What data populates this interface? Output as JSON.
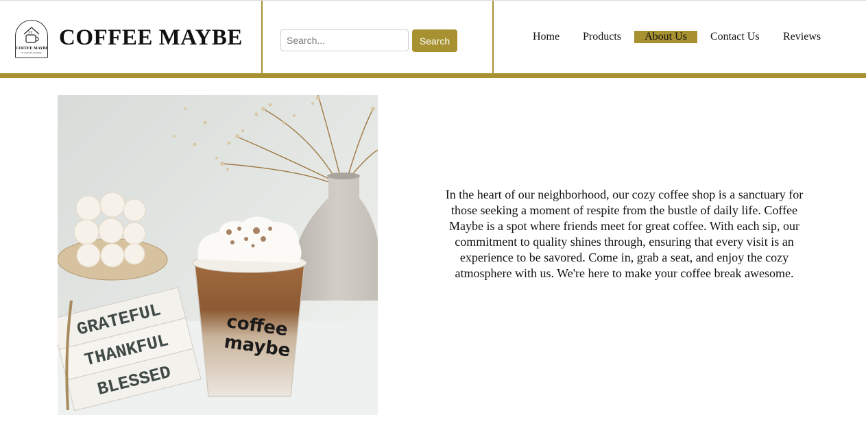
{
  "logo": {
    "line1": "COFFEE MAYBE",
    "line2": "\"It could be anything\"",
    "icon": "coffee-cup-house-icon"
  },
  "brand": {
    "name": "COFFEE MAYBE"
  },
  "search": {
    "placeholder": "Search...",
    "value": "",
    "button_label": "Search"
  },
  "nav": {
    "items": [
      {
        "label": "Home",
        "active": false
      },
      {
        "label": "Products",
        "active": false
      },
      {
        "label": "About Us",
        "active": true
      },
      {
        "label": "Contact Us",
        "active": false
      },
      {
        "label": "Reviews",
        "active": false
      }
    ]
  },
  "hero_image": {
    "cup_text_line1": "coffee",
    "cup_text_line2": "maybe",
    "book_lines": [
      "GRATEFUL",
      "THANKFUL",
      "BLESSED"
    ]
  },
  "about": {
    "paragraph": "In the heart of our neighborhood, our cozy coffee shop is a sanctuary for those seeking a moment of respite from the bustle of daily life. Coffee Maybe is a spot where friends meet for great coffee. With each sip, our commitment to quality shines through, ensuring that every visit is an experience to be savored. Come in, grab a seat, and enjoy the cozy atmosphere with us. We're here to make your coffee break awesome."
  },
  "colors": {
    "accent": "#a89130",
    "background": "#ffffff",
    "text": "#111111"
  }
}
